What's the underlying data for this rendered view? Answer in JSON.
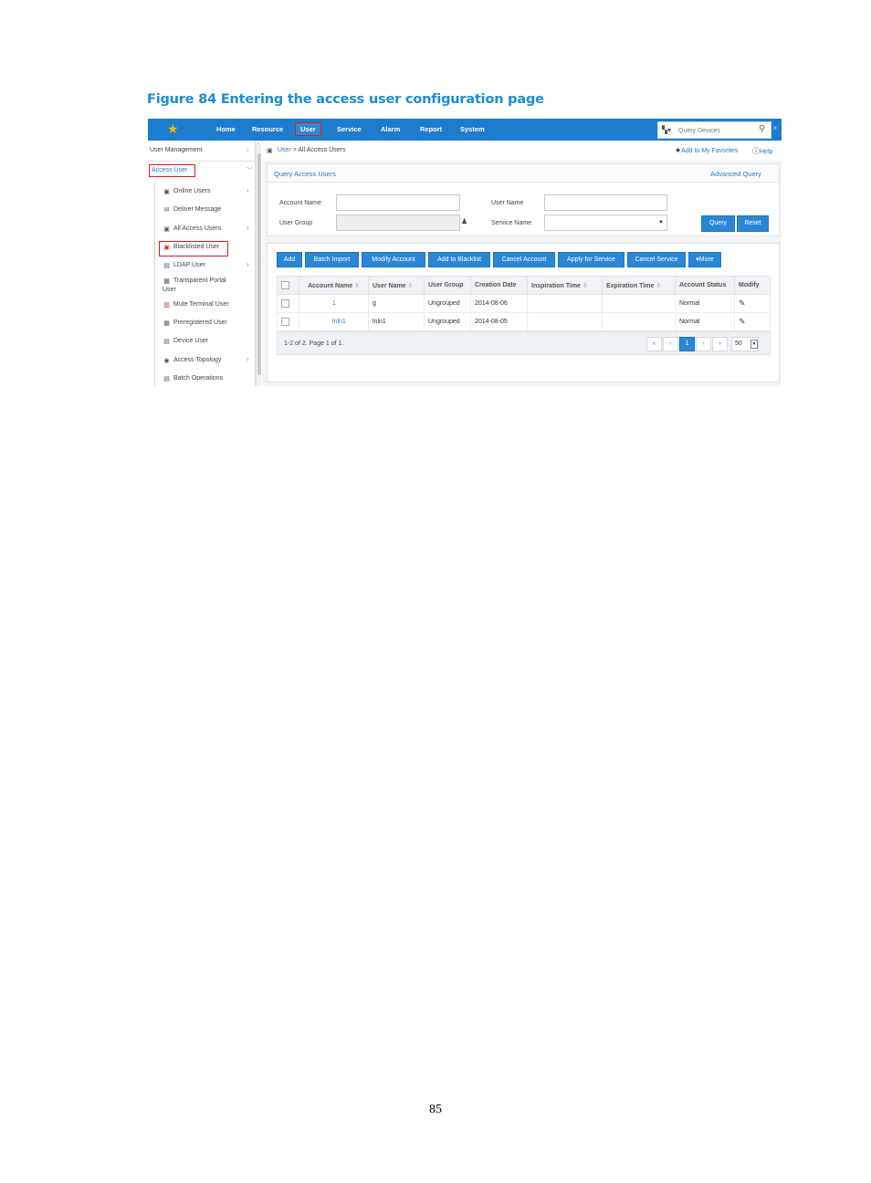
{
  "figure_title": "Figure 84 Entering the access user configuration page",
  "page_number": "85",
  "topnav": {
    "items": [
      "Home",
      "Resource",
      "User",
      "Service",
      "Alarm",
      "Report",
      "System"
    ],
    "search_placeholder": "Query Devices"
  },
  "sidebar": {
    "header": "User Management",
    "section": "Access User",
    "items": [
      {
        "label": "Online Users",
        "icon": "online-users-icon"
      },
      {
        "label": "Deliver Message",
        "icon": "message-icon"
      },
      {
        "label": "All Access Users",
        "icon": "users-icon"
      },
      {
        "label": "Blacklisted User",
        "icon": "blacklist-icon"
      },
      {
        "label": "LDAP User",
        "icon": "ldap-icon"
      },
      {
        "label": "Transparent Portal User",
        "icon": "portal-icon"
      },
      {
        "label": "Mute Terminal User",
        "icon": "terminal-icon"
      },
      {
        "label": "Preregistered User",
        "icon": "prereg-icon"
      },
      {
        "label": "Device User",
        "icon": "device-icon"
      },
      {
        "label": "Access Topology",
        "icon": "topology-icon"
      },
      {
        "label": "Batch Operations",
        "icon": "batch-icon"
      }
    ]
  },
  "breadcrumb": {
    "root": "User",
    "sep": " > ",
    "current": "All Access Users"
  },
  "header_links": {
    "favorites": "Add to My Favorites",
    "help": "Help"
  },
  "query": {
    "title": "Query Access Users",
    "advanced": "Advanced Query",
    "account_name_label": "Account Name",
    "user_name_label": "User Name",
    "user_group_label": "User Group",
    "service_name_label": "Service Name",
    "query_button": "Query",
    "reset_button": "Reset"
  },
  "toolbar": [
    "Add",
    "Batch Import",
    "Modify Account",
    "Add to Blacklist",
    "Cancel Account",
    "Apply for Service",
    "Cancel Service",
    "▾More"
  ],
  "table": {
    "columns": [
      "Account Name",
      "User Name",
      "User Group",
      "Creation Date",
      "Inspiration Time",
      "Expiration Time",
      "Account Status",
      "Modify"
    ],
    "rows": [
      {
        "account": "1",
        "user": "g",
        "group": "Ungrouped",
        "created": "2014-08-06",
        "inspiration": "",
        "expiration": "",
        "status": "Normal"
      },
      {
        "account": "lnln1",
        "user": "lnln1",
        "group": "Ungrouped",
        "created": "2014-08-05",
        "inspiration": "",
        "expiration": "",
        "status": "Normal"
      }
    ]
  },
  "pager": {
    "summary": "1-2 of 2. Page 1 of 1.",
    "first": "«",
    "prev": "‹",
    "current": "1",
    "next": "›",
    "last": "»",
    "page_size": "50"
  },
  "colors": {
    "brand": "#1e7ccd",
    "highlight": "#e0181e",
    "star": "#f7b500"
  }
}
